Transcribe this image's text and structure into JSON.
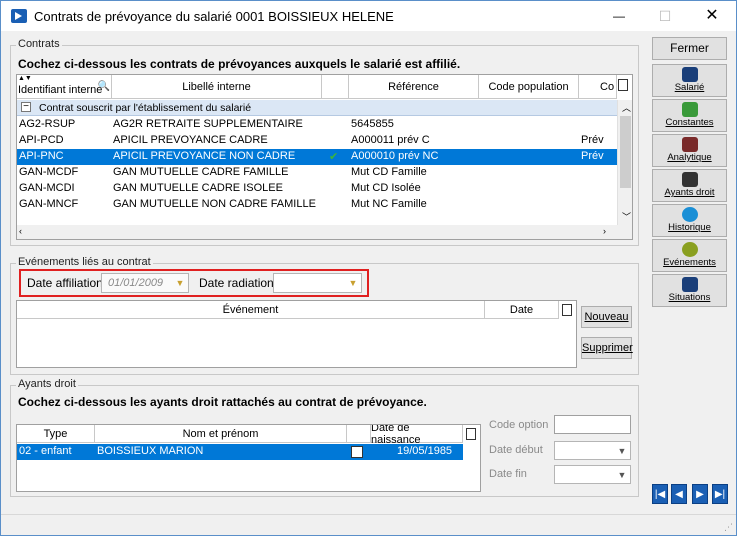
{
  "window": {
    "title": "Contrats de prévoyance du salarié 0001 BOISSIEUX HELENE",
    "min": "—",
    "max": "☐",
    "close": "✕"
  },
  "contrats": {
    "legend": "Contrats",
    "instruction": "Cochez ci-dessous les contrats de prévoyances auxquels le salarié est affilié.",
    "columns": [
      "Identifiant interne",
      "Libellé interne",
      "Référence",
      "Code population",
      "Co"
    ],
    "group_label": "Contrat souscrit par l'établissement du salarié",
    "rows": [
      {
        "id": "AG2-RSUP",
        "libelle": "AG2R RETRAITE SUPPLEMENTAIRE",
        "checked": "",
        "ref": "5645855",
        "pop": "",
        "co": ""
      },
      {
        "id": "API-PCD",
        "libelle": "APICIL PREVOYANCE CADRE",
        "checked": "",
        "ref": "A000011 prév C",
        "pop": "",
        "co": "Prév"
      },
      {
        "id": "API-PNC",
        "libelle": "APICIL PREVOYANCE NON CADRE",
        "checked": "✔",
        "ref": "A000010 prév NC",
        "pop": "",
        "co": "Prév"
      },
      {
        "id": "GAN-MCDF",
        "libelle": "GAN MUTUELLE CADRE FAMILLE",
        "checked": "",
        "ref": "Mut CD Famille",
        "pop": "",
        "co": ""
      },
      {
        "id": "GAN-MCDI",
        "libelle": "GAN MUTUELLE CADRE ISOLEE",
        "checked": "",
        "ref": "Mut CD Isolée",
        "pop": "",
        "co": ""
      },
      {
        "id": "GAN-MNCF",
        "libelle": "GAN MUTUELLE NON CADRE FAMILLE",
        "checked": "",
        "ref": "Mut  NC Famille",
        "pop": "",
        "co": ""
      }
    ]
  },
  "evenements": {
    "legend": "Evénements liés au contrat",
    "date_affiliation_label": "Date affiliation",
    "date_affiliation_value": "01/01/2009",
    "date_radiation_label": "Date radiation",
    "date_radiation_value": "",
    "columns": [
      "Événement",
      "Date"
    ],
    "nouveau": "Nouveau",
    "supprimer": "Supprimer"
  },
  "ayants": {
    "legend": "Ayants droit",
    "instruction": "Cochez ci-dessous les ayants droit rattachés au contrat de prévoyance.",
    "columns": [
      "Type",
      "Nom et prénom",
      "Date de naissance"
    ],
    "rows": [
      {
        "type": "02 - enfant",
        "nom": "BOISSIEUX MARION",
        "date": "19/05/1985"
      }
    ],
    "code_option_label": "Code option",
    "date_debut_label": "Date début",
    "date_fin_label": "Date fin"
  },
  "sidebar": {
    "fermer": "Fermer",
    "items": [
      {
        "label": "Salarié",
        "icon": "people-icon"
      },
      {
        "label": "Constantes",
        "icon": "constants-icon"
      },
      {
        "label": "Analytique",
        "icon": "chart-icon"
      },
      {
        "label": "Ayants droit",
        "icon": "dependents-icon"
      },
      {
        "label": "Historique",
        "icon": "clock-icon"
      },
      {
        "label": "Evénements",
        "icon": "events-icon"
      },
      {
        "label": "Situations",
        "icon": "film-icon"
      }
    ]
  },
  "nav": {
    "first": "|◀",
    "prev": "◀",
    "next": "▶",
    "last": "▶|"
  },
  "colors": {
    "selection": "#0078d7",
    "group_header": "#dbe7f5",
    "highlight_box": "#e02020",
    "accent": "#1a5fb4"
  }
}
